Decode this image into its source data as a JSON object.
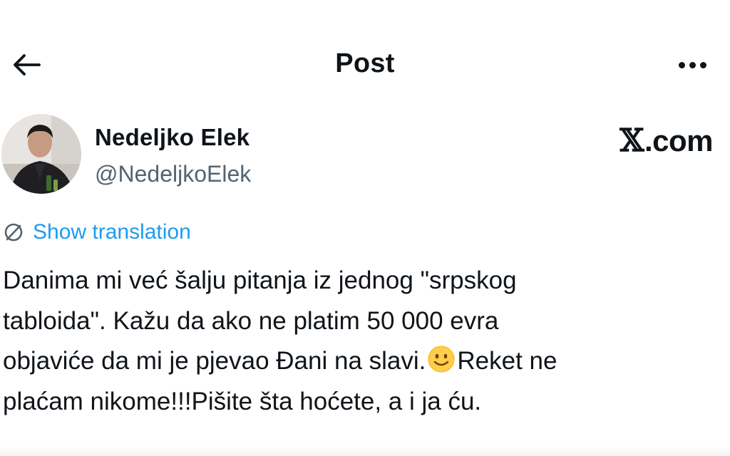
{
  "header": {
    "title": "Post"
  },
  "icons": {
    "back": "arrow-left-icon",
    "more": "more-horizontal-icon",
    "translate": "translate-icon",
    "emoji": "slightly-smiling-face-emoji"
  },
  "author": {
    "name": "Nedeljko Elek",
    "handle": "@NedeljkoElek"
  },
  "site_logo": {
    "mark": "𝕏",
    "text": ".com"
  },
  "translation": {
    "label": "Show translation"
  },
  "post": {
    "line1": "Danima mi već šalju pitanja iz jednog \"srpskog",
    "line2": "tabloida\". Kažu da ako ne platim 50 000 evra",
    "line3_before_emoji": "objaviće da mi je pjevao Đani na slavi.",
    "line3_after_emoji": "Reket ne",
    "line4": "plaćam nikome!!!Pišite šta hoćete, a i ja ću."
  },
  "colors": {
    "text": "#0f1419",
    "secondary": "#536471",
    "accent": "#1d9bf0"
  }
}
